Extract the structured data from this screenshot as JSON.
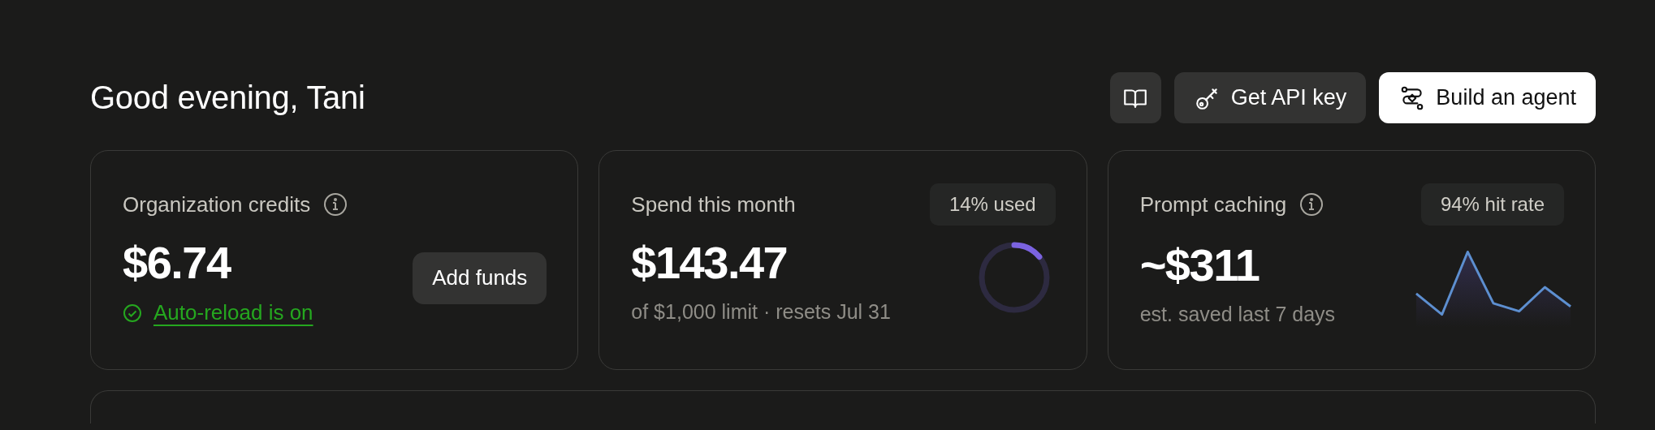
{
  "header": {
    "greeting": "Good evening, Tani",
    "buttons": [
      {
        "kind": "icon"
      },
      {
        "kind": "secondary",
        "label": "Get API key"
      },
      {
        "kind": "primary",
        "label": "Build an agent"
      }
    ]
  },
  "cards": [
    {
      "kind": "credits",
      "title": "Organization credits",
      "info": true,
      "amount": "$6.74",
      "action": "Add funds",
      "status": {
        "label": "Auto-reload is on",
        "on": true
      }
    },
    {
      "kind": "spend",
      "title": "Spend this month",
      "badge": "14% used",
      "amount": "$143.47",
      "note": "of $1,000 limit · resets Jul 31",
      "level": 0.14
    },
    {
      "kind": "caching",
      "title": "Prompt caching",
      "info": true,
      "badge": "94% hit rate",
      "amount": "~$311",
      "note": "est. saved last 7 days"
    }
  ],
  "lower_panel": {
    "kind": "panel"
  }
}
